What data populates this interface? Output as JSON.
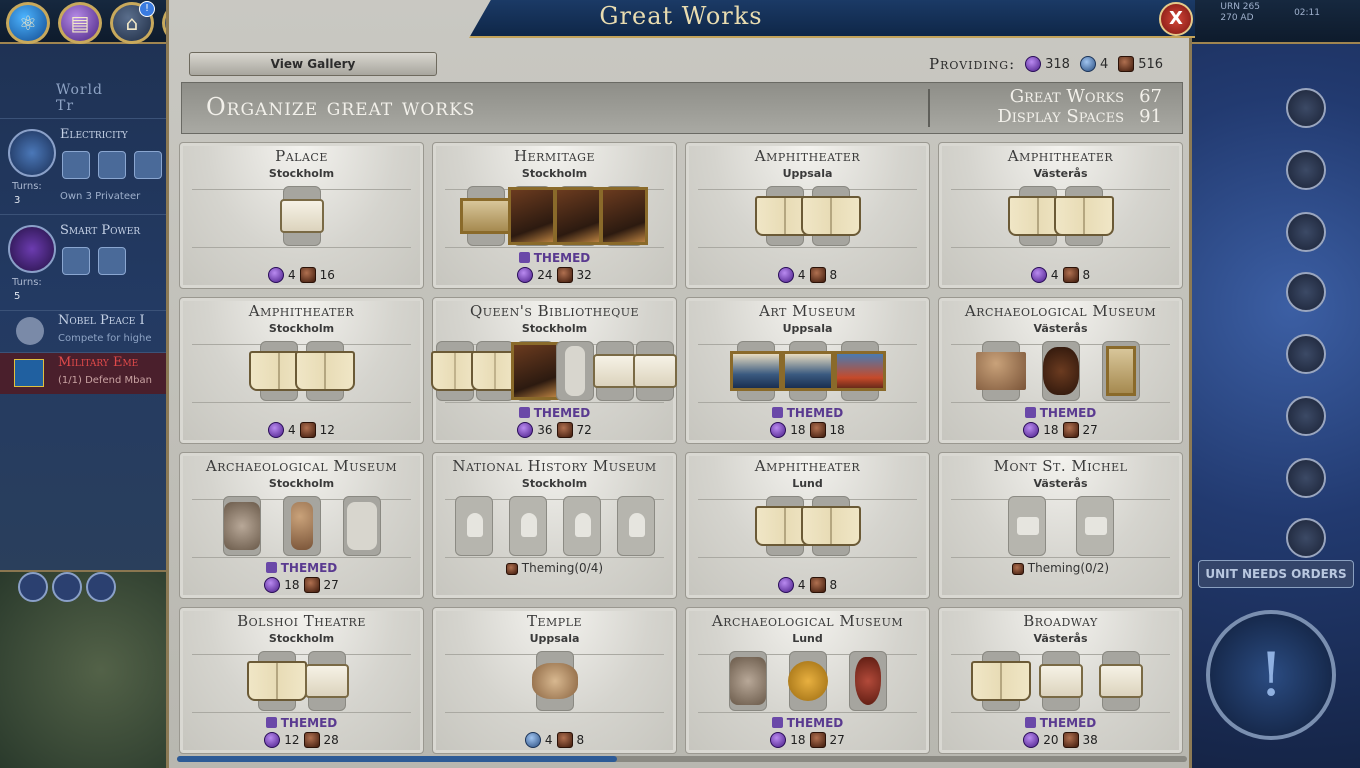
{
  "modal": {
    "title": "Great Works",
    "close_label": "X",
    "view_gallery": "View Gallery",
    "providing_label": "Providing:",
    "providing_culture": "318",
    "providing_faith": "4",
    "providing_tourism": "516",
    "organize_title": "Organize great works",
    "great_works_label": "Great Works",
    "great_works_value": "67",
    "display_spaces_label": "Display Spaces",
    "display_spaces_value": "91"
  },
  "cards": [
    {
      "name": "Palace",
      "city": "Stockholm",
      "culture": "4",
      "tourism": "16"
    },
    {
      "name": "Hermitage",
      "city": "Stockholm",
      "themed": "THEMED",
      "culture": "24",
      "tourism": "32"
    },
    {
      "name": "Amphitheater",
      "city": "Uppsala",
      "culture": "4",
      "tourism": "8"
    },
    {
      "name": "Amphitheater",
      "city": "Västerås",
      "culture": "4",
      "tourism": "8"
    },
    {
      "name": "Amphitheater",
      "city": "Stockholm",
      "culture": "4",
      "tourism": "12"
    },
    {
      "name": "Queen's Bibliotheque",
      "city": "Stockholm",
      "themed": "THEMED",
      "culture": "36",
      "tourism": "72"
    },
    {
      "name": "Art Museum",
      "city": "Uppsala",
      "themed": "THEMED",
      "culture": "18",
      "tourism": "18"
    },
    {
      "name": "Archaeological Museum",
      "city": "Västerås",
      "themed": "THEMED",
      "culture": "18",
      "tourism": "27"
    },
    {
      "name": "Archaeological Museum",
      "city": "Stockholm",
      "themed": "THEMED",
      "culture": "18",
      "tourism": "27"
    },
    {
      "name": "National History Museum",
      "city": "Stockholm",
      "theming": "Theming(0/4)"
    },
    {
      "name": "Amphitheater",
      "city": "Lund",
      "culture": "4",
      "tourism": "8"
    },
    {
      "name": "Mont St. Michel",
      "city": "Västerås",
      "theming": "Theming(0/2)"
    },
    {
      "name": "Bolshoi Theatre",
      "city": "Stockholm",
      "themed": "THEMED",
      "culture": "12",
      "tourism": "28"
    },
    {
      "name": "Temple",
      "city": "Uppsala",
      "faith": "4",
      "tourism": "8"
    },
    {
      "name": "Archaeological Museum",
      "city": "Lund",
      "themed": "THEMED",
      "culture": "18",
      "tourism": "27"
    },
    {
      "name": "Broadway",
      "city": "Västerås",
      "themed": "THEMED",
      "culture": "20",
      "tourism": "38"
    }
  ],
  "left_panel": {
    "title": "World Tr",
    "tech_name": "Electricity",
    "tech_turns_label": "Turns:",
    "tech_turns": "3",
    "tech_sub": "Own 3 Privateer",
    "civic_name": "Smart Power",
    "civic_turns_label": "Turns:",
    "civic_turns": "5",
    "nobel_name": "Nobel Peace I",
    "nobel_sub": "Compete for highe",
    "military_name": "Military Eme",
    "military_sub": "(1/1) Defend Mban"
  },
  "right_hud": {
    "unit_orders": "UNIT NEEDS ORDERS",
    "era_line1": "URN 265",
    "era_line2": "270 AD",
    "clock": "02:11"
  },
  "colors": {
    "accent_gold": "#c4a45a",
    "themed_purple": "#5a3a90",
    "header_blue": "#1b3a66",
    "close_red": "#c43a2e"
  },
  "icons": [
    "science-icon",
    "civics-icon",
    "government-icon",
    "religion-icon",
    "great-people-icon",
    "great-works-icon",
    "climate-icon",
    "governors-icon",
    "trade-icon"
  ]
}
